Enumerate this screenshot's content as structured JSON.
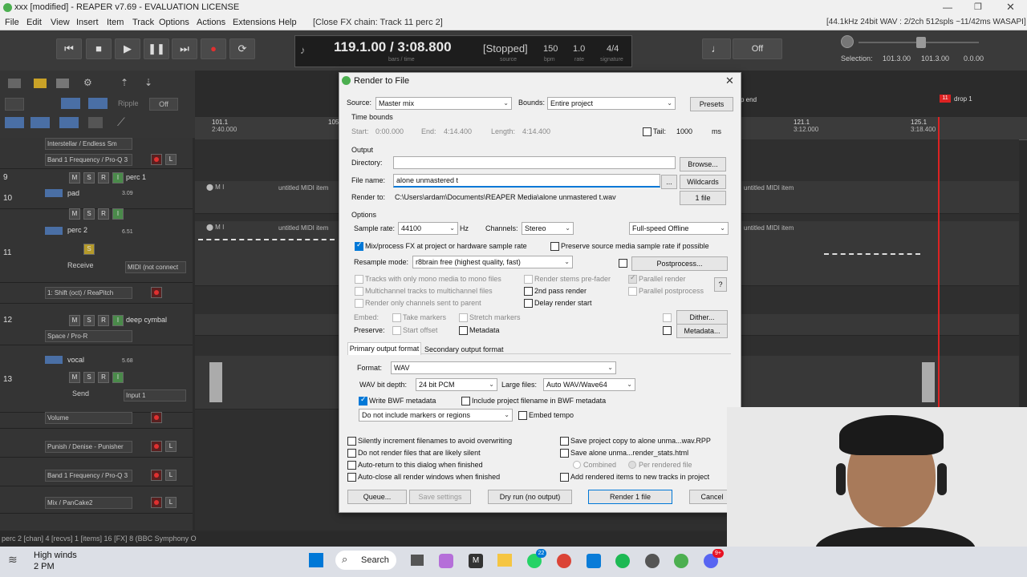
{
  "window": {
    "title": "xxx [modified] - REAPER v7.69 - EVALUATION LICENSE"
  },
  "menu": {
    "items": [
      "File",
      "Edit",
      "View",
      "Insert",
      "Item",
      "Track",
      "Options",
      "Actions",
      "Extensions",
      "Help"
    ],
    "status": "[Close FX chain: Track 11 perc 2]",
    "audio_status": "[44.1kHz 24bit WAV : 2/2ch 512spls ~11/42ms WASAPI]"
  },
  "transport": {
    "position": "119.1.00 / 3:08.800",
    "position_sub": "bars / time",
    "state": "[Stopped]",
    "state_sub": "source",
    "bpm": "150",
    "bpm_sub": "bpm",
    "rate": "1.0",
    "rate_sub": "rate",
    "sig": "4/4",
    "sig_sub": "signature",
    "off": "Off",
    "selection_label": "Selection:",
    "sel_start": "101.3.00",
    "sel_end": "101.3.00",
    "sel_len": "0.0.00"
  },
  "toolbar": {
    "ripple_label": "Ripple",
    "ripple_value": "Off"
  },
  "ruler": {
    "marks": [
      {
        "bar": "101.1",
        "time": "2:40.000"
      },
      {
        "bar": "105",
        "time": ""
      },
      {
        "bar": "121.1",
        "time": "3:12.000"
      },
      {
        "bar": "125.1",
        "time": "3:18.400"
      }
    ],
    "marker_end": "p end",
    "region_num": "11",
    "region_name": "drop 1"
  },
  "tracks": [
    {
      "num": "",
      "name": "Interstellar / Endless Sm",
      "fx": "Band 1 Frequency / Pro-Q 3"
    },
    {
      "num": "9",
      "name": "perc 1"
    },
    {
      "num": "10",
      "name": "pad",
      "vol": "3.09"
    },
    {
      "num": "11",
      "name": "perc 2",
      "vol": "6.51",
      "receive": "Receive",
      "midi": "MIDI (not connect",
      "fx": "1: Shift (oct) / ReaPitch"
    },
    {
      "num": "12",
      "name": "deep cymbal",
      "fx": "Space / Pro-R"
    },
    {
      "num": "13",
      "name": "vocal",
      "vol": "5.68",
      "send": "Send",
      "input": "Input 1",
      "env1": "Volume",
      "env2": "Punish / Denise - Punisher",
      "env3": "Band 1 Frequency / Pro-Q 3",
      "env4": "Mix / PanCake2"
    }
  ],
  "lane_item_label": "untitled MIDI item",
  "dialog": {
    "title": "Render to File",
    "source_label": "Source:",
    "source_value": "Master mix",
    "bounds_label": "Bounds:",
    "bounds_value": "Entire project",
    "presets": "Presets",
    "time_bounds": "Time bounds",
    "start_label": "Start:",
    "start_value": "0:00.000",
    "end_label": "End:",
    "end_value": "4:14.400",
    "length_label": "Length:",
    "length_value": "4:14.400",
    "tail_label": "Tail:",
    "tail_value": "1000",
    "tail_unit": "ms",
    "output": "Output",
    "directory_label": "Directory:",
    "directory_value": "",
    "browse": "Browse...",
    "filename_label": "File name:",
    "filename_value": "alone unmastered t",
    "dots": "...",
    "wildcards": "Wildcards",
    "renderto_label": "Render to:",
    "renderto_value": "C:\\Users\\ardam\\Documents\\REAPER Media\\alone unmastered t.wav",
    "files_count": "1 file",
    "options": "Options",
    "samplerate_label": "Sample rate:",
    "samplerate_value": "44100",
    "hz": "Hz",
    "channels_label": "Channels:",
    "channels_value": "Stereo",
    "speed_value": "Full-speed Offline",
    "mixfx": "Mix/process FX at project or hardware sample rate",
    "preserve_rate": "Preserve source media sample rate if possible",
    "resample_label": "Resample mode:",
    "resample_value": "r8brain free (highest quality, fast)",
    "postprocess": "Postprocess...",
    "mono_tracks": "Tracks with only mono media to mono files",
    "render_stems": "Render stems pre-fader",
    "parallel_render": "Parallel render",
    "multichannel": "Multichannel tracks to multichannel files",
    "second_pass": "2nd pass render",
    "parallel_post": "Parallel postprocess",
    "help": "?",
    "only_channels": "Render only channels sent to parent",
    "delay_start": "Delay render start",
    "embed_label": "Embed:",
    "take_markers": "Take markers",
    "stretch_markers": "Stretch markers",
    "dither": "Dither...",
    "preserve_label": "Preserve:",
    "start_offset": "Start offset",
    "metadata_cb": "Metadata",
    "metadata_btn": "Metadata...",
    "tab_primary": "Primary output format",
    "tab_secondary": "Secondary output format",
    "format_label": "Format:",
    "format_value": "WAV",
    "bitdepth_label": "WAV bit depth:",
    "bitdepth_value": "24 bit PCM",
    "largefiles_label": "Large files:",
    "largefiles_value": "Auto WAV/Wave64",
    "write_bwf": "Write BWF metadata",
    "include_fn": "Include project filename in BWF metadata",
    "markers_value": "Do not include markers or regions",
    "embed_tempo": "Embed tempo",
    "silently": "Silently increment filenames to avoid overwriting",
    "do_not_render": "Do not render files that are likely silent",
    "auto_return": "Auto-return to this dialog when finished",
    "auto_close": "Auto-close all render windows when finished",
    "save_copy": "Save project copy to alone unma...wav.RPP",
    "save_stats": "Save alone unma...render_stats.html",
    "combined": "Combined",
    "per_rendered": "Per rendered file",
    "add_rendered": "Add rendered items to new tracks in project",
    "queue": "Queue...",
    "save_settings": "Save settings",
    "dry_run": "Dry run (no output)",
    "render": "Render 1 file",
    "cancel": "Cancel"
  },
  "statusbar": {
    "text": "perc 2 [chan] 4 [recvs] 1 [items] 16 [FX] 8 (BBC Symphony O"
  },
  "taskbar": {
    "weather_title": "High winds",
    "weather_sub": "2 PM",
    "search": "Search",
    "whatsapp_badge": "22",
    "discord_badge": "9+"
  }
}
